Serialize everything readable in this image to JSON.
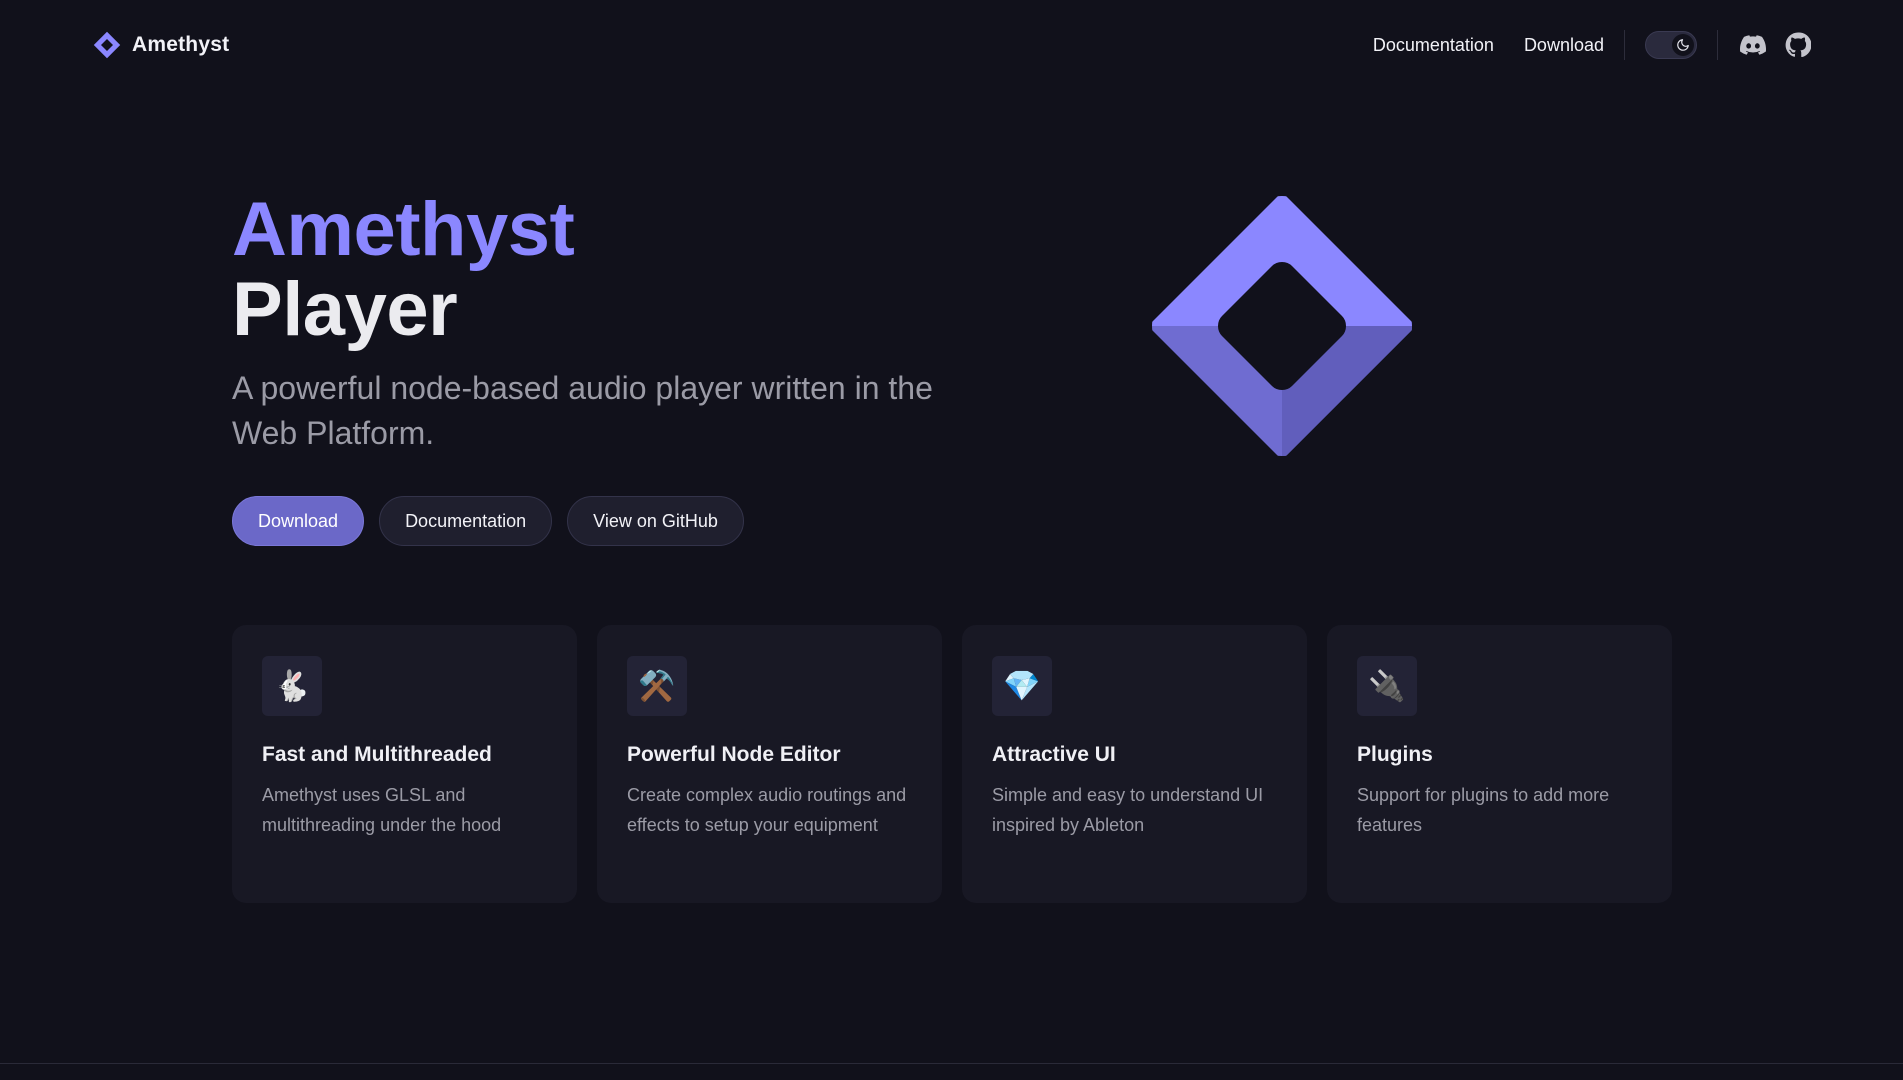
{
  "colors": {
    "background": "#11111b",
    "accent": "#8b87ff",
    "primary_button": "#6b68c8",
    "card_background": "#181824"
  },
  "nav": {
    "brand_name": "Amethyst",
    "brand_icon": "amethyst-diamond-logo",
    "links": [
      {
        "label": "Documentation"
      },
      {
        "label": "Download"
      }
    ],
    "theme_toggle": {
      "state": "dark",
      "icon": "moon-icon"
    },
    "social": [
      {
        "name": "discord",
        "icon": "discord-icon"
      },
      {
        "name": "github",
        "icon": "github-icon"
      }
    ]
  },
  "hero": {
    "title_accent": "Amethyst",
    "title_plain": "Player",
    "tagline": "A powerful node-based audio player written in the Web Platform.",
    "actions": [
      {
        "label": "Download",
        "style": "primary"
      },
      {
        "label": "Documentation",
        "style": "secondary"
      },
      {
        "label": "View on GitHub",
        "style": "secondary"
      }
    ]
  },
  "features": [
    {
      "icon": "rabbit-icon",
      "emoji": "🐇",
      "title": "Fast and Multithreaded",
      "description": "Amethyst uses GLSL and multithreading under the hood"
    },
    {
      "icon": "hammer-and-pick-icon",
      "emoji": "⚒️",
      "title": "Powerful Node Editor",
      "description": "Create complex audio routings and effects to setup your equipment"
    },
    {
      "icon": "gem-icon",
      "emoji": "💎",
      "title": "Attractive UI",
      "description": "Simple and easy to understand UI inspired by Ableton"
    },
    {
      "icon": "plug-icon",
      "emoji": "🔌",
      "title": "Plugins",
      "description": "Support for plugins to add more features"
    }
  ]
}
